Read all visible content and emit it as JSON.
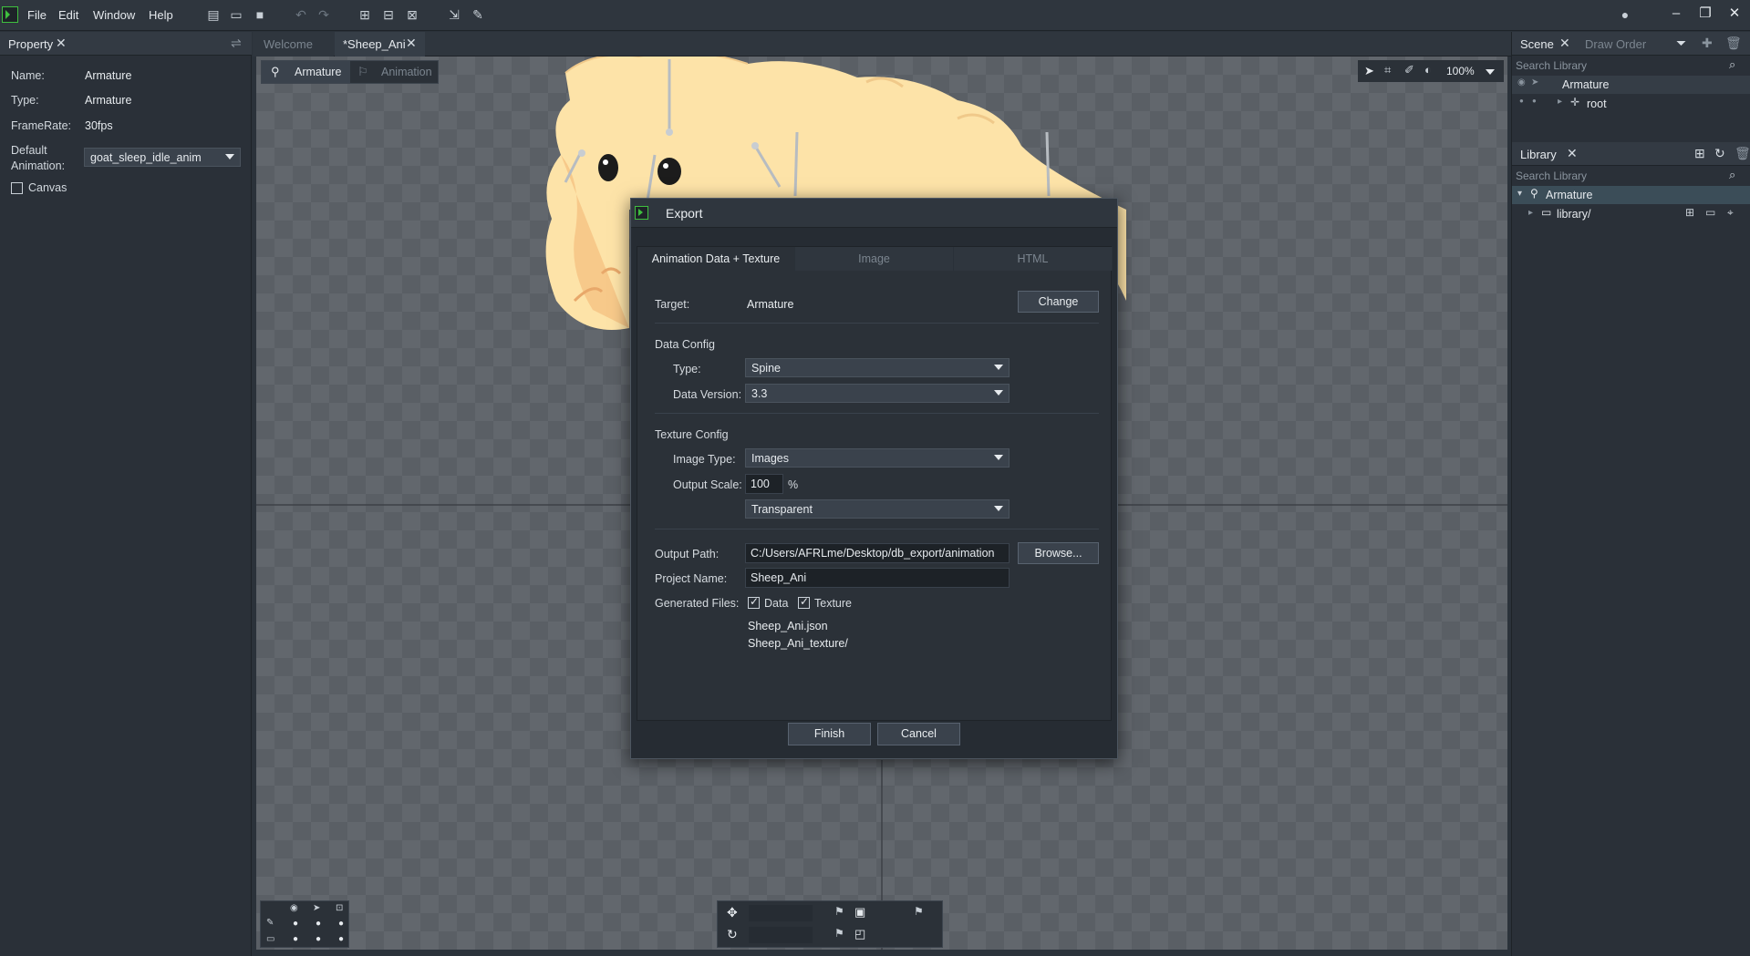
{
  "menu": {
    "file": "File",
    "edit": "Edit",
    "window": "Window",
    "help": "Help"
  },
  "tabs": {
    "welcome": "Welcome",
    "sheep": "*Sheep_Ani"
  },
  "property": {
    "title": "Property",
    "name_label": "Name:",
    "name_value": "Armature",
    "type_label": "Type:",
    "type_value": "Armature",
    "framerate_label": "FrameRate:",
    "framerate_value": "30fps",
    "default_anim_label_1": "Default",
    "default_anim_label_2": "Animation:",
    "default_anim_value": "goat_sleep_idle_anim",
    "canvas_label": "Canvas"
  },
  "canvas": {
    "mode_armature": "Armature",
    "mode_animation": "Animation",
    "zoom": "100%"
  },
  "scene": {
    "tab_scene": "Scene",
    "tab_draw_order": "Draw Order",
    "search_placeholder": "Search Library",
    "items": [
      "Armature",
      "root"
    ]
  },
  "library": {
    "title": "Library",
    "search_placeholder": "Search Library",
    "items": [
      "Armature",
      "library/"
    ]
  },
  "export": {
    "title": "Export",
    "tabs": [
      "Animation Data + Texture",
      "Image",
      "HTML"
    ],
    "target_label": "Target:",
    "target_value": "Armature",
    "change_button": "Change",
    "data_config_title": "Data Config",
    "type_label": "Type:",
    "type_value": "Spine",
    "data_version_label": "Data Version:",
    "data_version_value": "3.3",
    "texture_config_title": "Texture Config",
    "image_type_label": "Image Type:",
    "image_type_value": "Images",
    "output_scale_label": "Output Scale:",
    "output_scale_value": "100",
    "output_scale_unit": "%",
    "background_value": "Transparent",
    "output_path_label": "Output Path:",
    "output_path_value": "C:/Users/AFRLme/Desktop/db_export/animation",
    "browse_button": "Browse...",
    "project_name_label": "Project Name:",
    "project_name_value": "Sheep_Ani",
    "generated_files_label": "Generated Files:",
    "gen_data_label": "Data",
    "gen_texture_label": "Texture",
    "files": [
      "Sheep_Ani.json",
      "Sheep_Ani_texture/"
    ],
    "finish_button": "Finish",
    "cancel_button": "Cancel"
  },
  "colors": {
    "accent": "#3fbf3f",
    "panel": "#2a3038",
    "selected": "#3b4d58"
  }
}
